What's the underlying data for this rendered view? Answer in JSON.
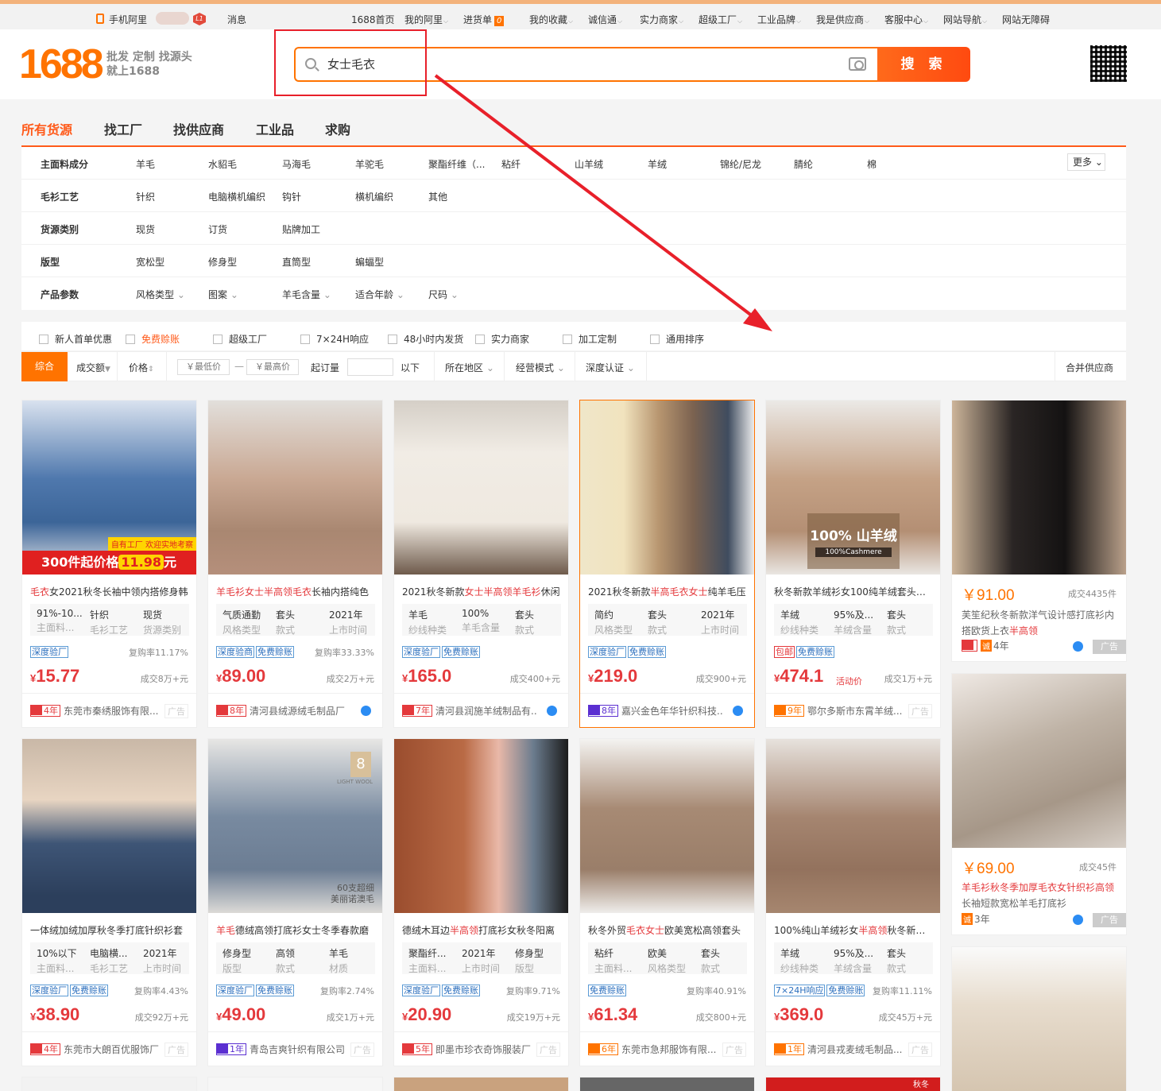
{
  "topbar": {
    "mobile": "手机阿里",
    "user_level": "L1",
    "messages": "消息",
    "links": [
      "1688首页",
      "我的阿里",
      "进货单",
      "我的收藏",
      "诚信通",
      "实力商家",
      "超级工厂",
      "工业品牌",
      "我是供应商",
      "客服中心",
      "网站导航",
      "网站无障碍"
    ],
    "cart_count": "0"
  },
  "header": {
    "logo": "1688",
    "slogan_line1": "批发 定制 找源头",
    "slogan_line2": "就上1688",
    "search_value": "女士毛衣",
    "search_button": "搜 索"
  },
  "category_tabs": [
    "所有货源",
    "找工厂",
    "找供应商",
    "工业品",
    "求购"
  ],
  "filters": [
    {
      "label": "主面料成分",
      "options": [
        "羊毛",
        "水貂毛",
        "马海毛",
        "羊驼毛",
        "聚酯纤维（...",
        "粘纤",
        "山羊绒",
        "羊绒",
        "锦纶/尼龙",
        "腈纶",
        "棉"
      ]
    },
    {
      "label": "毛衫工艺",
      "options": [
        "针织",
        "电脑横机编织",
        "钩针",
        "横机编织",
        "其他"
      ]
    },
    {
      "label": "货源类别",
      "options": [
        "现货",
        "订货",
        "贴牌加工"
      ]
    },
    {
      "label": "版型",
      "options": [
        "宽松型",
        "修身型",
        "直筒型",
        "蝙蝠型"
      ]
    },
    {
      "label": "产品参数",
      "options": [
        "风格类型",
        "图案",
        "羊毛含量",
        "适合年龄",
        "尺码"
      ]
    }
  ],
  "more_label": "更多",
  "checkboxes": [
    "新人首单优惠",
    "免费赊账",
    "超级工厂",
    "7×24H响应",
    "48小时内发货",
    "实力商家",
    "加工定制",
    "通用排序"
  ],
  "sort": {
    "active": "综合",
    "volume": "成交额",
    "price": "价格",
    "min_price": "￥最低价",
    "dash": "—",
    "max_price": "￥最高价",
    "moq": "起订量",
    "below": "以下",
    "region": "所在地区",
    "mode": "经营模式",
    "cert": "深度认证",
    "merge": "合并供应商"
  },
  "banners": {
    "p1_caption_prefix": "300件起价格",
    "p1_caption_price": "11.98",
    "p1_caption_suffix": "元",
    "p1_tag": "自有工厂 欢迎实地考察",
    "p5_caption": "100% 山羊绒",
    "p5_caption_sub": "100%Cashmere",
    "p8_badge": "8",
    "p8_badge_sub": "LIGHT WOOL",
    "p8_sub1": "60支超细",
    "p8_sub2": "美丽诺澳毛"
  },
  "products": [
    {
      "title_pre": "",
      "title_hl": "毛衣",
      "title_rest": "女2021秋冬长袖中领内搭修身韩",
      "attrs": [
        [
          "91%-10...",
          "主面料..."
        ],
        [
          "针织",
          "毛衫工艺"
        ],
        [
          "现货",
          "货源类别"
        ]
      ],
      "tags": [
        "深度验厂"
      ],
      "repurchase": "复购率11.17%",
      "price": "15.77",
      "volume": "成交8万+元",
      "years": "4年",
      "seller": "东莞市秦绣服饰有限...",
      "ad": "广告"
    },
    {
      "title_pre": "",
      "title_hl": "羊毛衫女士半高领毛衣",
      "title_rest": "长袖内搭纯色",
      "attrs": [
        [
          "气质通勤",
          "风格类型"
        ],
        [
          "套头",
          "款式"
        ],
        [
          "2021年",
          "上市时间"
        ]
      ],
      "tags": [
        "深度验商",
        "免费赊账"
      ],
      "repurchase": "复购率33.33%",
      "price": "89.00",
      "volume": "成交2万+元",
      "years": "8年",
      "seller": "清河县绒源绒毛制品厂",
      "ad": ""
    },
    {
      "title_pre": "2021秋冬新款",
      "title_hl": "女士半高领羊毛衫",
      "title_rest": "休闲",
      "attrs": [
        [
          "羊毛",
          "纱线种类"
        ],
        [
          "100%",
          "羊毛含量"
        ],
        [
          "套头",
          "款式"
        ]
      ],
      "tags": [
        "深度验厂",
        "免费赊账"
      ],
      "repurchase": "",
      "price": "165.0",
      "volume": "成交400+元",
      "years": "7年",
      "seller": "清河县润施羊绒制品有...",
      "ad": ""
    },
    {
      "title_pre": "2021秋冬新款",
      "title_hl": "半高毛衣女士",
      "title_rest": "纯羊毛压",
      "attrs": [
        [
          "简约",
          "风格类型"
        ],
        [
          "套头",
          "款式"
        ],
        [
          "2021年",
          "上市时间"
        ]
      ],
      "tags": [
        "深度验厂",
        "免费赊账"
      ],
      "repurchase": "",
      "price": "219.0",
      "volume": "成交900+元",
      "years": "8年",
      "seller": "嘉兴金色年华针织科技...",
      "ad": ""
    },
    {
      "title_pre": "秋冬新款羊绒衫女100纯羊绒套头堆堆",
      "title_hl": "",
      "title_rest": "",
      "attrs": [
        [
          "羊绒",
          "纱线种类"
        ],
        [
          "95%及...",
          "羊绒含量"
        ],
        [
          "套头",
          "款式"
        ]
      ],
      "tags": [
        "包邮",
        "免费赊账"
      ],
      "repurchase": "",
      "price": "474.1",
      "activity": "活动价",
      "volume": "成交1万+元",
      "years": "9年",
      "seller": "鄂尔多斯市东霄羊绒...",
      "ad": "广告"
    },
    {
      "title_pre": "一体绒加绒加厚秋冬季打底针织衫套",
      "title_hl": "",
      "title_rest": "",
      "attrs": [
        [
          "10%以下",
          "主面料..."
        ],
        [
          "电脑横...",
          "毛衫工艺"
        ],
        [
          "2021年",
          "上市时间"
        ]
      ],
      "tags": [
        "深度验厂",
        "免费赊账"
      ],
      "repurchase": "复购率4.43%",
      "price": "38.90",
      "volume": "成交92万+元",
      "years": "4年",
      "seller": "东莞市大朗百优服饰厂",
      "ad": "广告"
    },
    {
      "title_pre": "",
      "title_hl": "羊毛",
      "title_rest": "德绒高领打底衫女士冬季春款磨",
      "attrs": [
        [
          "修身型",
          "版型"
        ],
        [
          "高领",
          "款式"
        ],
        [
          "羊毛",
          "材质"
        ]
      ],
      "tags": [
        "深度验厂",
        "免费赊账"
      ],
      "repurchase": "复购率2.74%",
      "price": "49.00",
      "volume": "成交1万+元",
      "years": "1年",
      "seller": "青岛吉爽针织有限公司",
      "ad": "广告"
    },
    {
      "title_pre": "德绒木耳边",
      "title_hl": "半高领",
      "title_rest": "打底衫女秋冬阳离",
      "attrs": [
        [
          "聚酯纤...",
          "主面料..."
        ],
        [
          "2021年",
          "上市时间"
        ],
        [
          "修身型",
          "版型"
        ]
      ],
      "tags": [
        "深度验厂",
        "免费赊账"
      ],
      "repurchase": "复购率9.71%",
      "price": "20.90",
      "volume": "成交19万+元",
      "years": "5年",
      "seller": "即墨市珍衣奇饰服装厂",
      "ad": "广告"
    },
    {
      "title_pre": "秋冬外贸",
      "title_hl": "毛衣女士",
      "title_rest": "欧美宽松高领套头",
      "attrs": [
        [
          "粘纤",
          "主面料..."
        ],
        [
          "欧美",
          "风格类型"
        ],
        [
          "套头",
          "款式"
        ]
      ],
      "tags": [
        "免费赊账"
      ],
      "repurchase": "复购率40.91%",
      "price": "61.34",
      "volume": "成交800+元",
      "years": "6年",
      "seller": "东莞市急邦服饰有限...",
      "ad": "广告"
    },
    {
      "title_pre": "100%纯山羊绒衫女",
      "title_hl": "半高领",
      "title_rest": "秋冬新抽条",
      "attrs": [
        [
          "羊绒",
          "纱线种类"
        ],
        [
          "95%及...",
          "羊绒含量"
        ],
        [
          "套头",
          "款式"
        ]
      ],
      "tags": [
        "7×24H响应",
        "免费赊账"
      ],
      "repurchase": "复购率11.11%",
      "price": "369.0",
      "volume": "成交45万+元",
      "years": "1年",
      "seller": "清河县戎麦绒毛制品...",
      "ad": "广告"
    }
  ],
  "ads": [
    {
      "price": "￥91.00",
      "volume": "成交4435件",
      "title_pre": "芙笙纪秋冬新款洋气设计感打底衫内搭欧货上衣",
      "title_hl": "半高领",
      "years": "4年",
      "badge": "广告"
    },
    {
      "price": "￥69.00",
      "volume": "成交45件",
      "title_pre": "",
      "title_hl": "羊毛衫秋冬季加厚毛衣女针织衫高领",
      "title_rest": "长袖短款宽松羊毛打底衫",
      "years": "3年",
      "badge": "广告"
    }
  ],
  "partial_row_label": "秋冬",
  "colors": {
    "brand": "#ff7300",
    "price": "#e4393c",
    "annotation": "#e8202a"
  }
}
